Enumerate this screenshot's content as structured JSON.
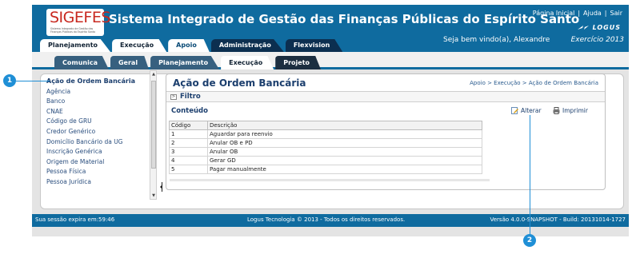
{
  "header": {
    "logo_text": "SIGEFES",
    "logo_subtitle": "Sistema Integrado de Gestão das Finanças Públicas do Espírito Santo",
    "app_title": "Sistema Integrado de Gestão das Finanças Públicas do Espírito Santo",
    "links": [
      "Página Inicial",
      "|",
      "Ajuda",
      "|",
      "Sair"
    ],
    "brand": "LOGUS",
    "welcome": "Seja bem vindo(a), Alexandre",
    "exercicio": "Exercício 2013"
  },
  "main_tabs": [
    "Planejamento",
    "Execução",
    "Apoio",
    "Administração",
    "Flexvision"
  ],
  "sub_tabs": [
    "Comunica",
    "Geral",
    "Planejamento",
    "Execução",
    "Projeto"
  ],
  "sidebar": {
    "items": [
      "Ação de Ordem Bancária",
      "Agência",
      "Banco",
      "CNAE",
      "Código de GRU",
      "Credor Genérico",
      "Domicílio Bancário da UG",
      "Inscrição Genérica",
      "Origem de Material",
      "Pessoa Física",
      "Pessoa Jurídica"
    ]
  },
  "panel": {
    "title": "Ação de Ordem Bancária",
    "breadcrumb": "Apoio > Execução > Ação de Ordem Bancária",
    "filtro": "Filtro",
    "conteudo": "Conteúdo",
    "alterar": "Alterar",
    "imprimir": "Imprimir"
  },
  "grid": {
    "columns": [
      "Código",
      "Descrição"
    ],
    "rows": [
      {
        "codigo": "1",
        "descricao": "Aguardar para reenvio"
      },
      {
        "codigo": "2",
        "descricao": "Anular OB e PD"
      },
      {
        "codigo": "3",
        "descricao": "Anular OB"
      },
      {
        "codigo": "4",
        "descricao": "Gerar GD"
      },
      {
        "codigo": "5",
        "descricao": "Pagar manualmente"
      }
    ]
  },
  "footer": {
    "session": "Sua sessão expira em:59:46",
    "copyright": "Logus Tecnologia © 2013 - Todos os direitos reservados.",
    "version": "Versão 4.0.0-SNAPSHOT - Build: 20131014-1727"
  },
  "callouts": [
    "1",
    "2"
  ],
  "colors": {
    "header_blue": "#0f6b9f",
    "callout": "#1f8fd6",
    "logo_red": "#c8281f"
  }
}
